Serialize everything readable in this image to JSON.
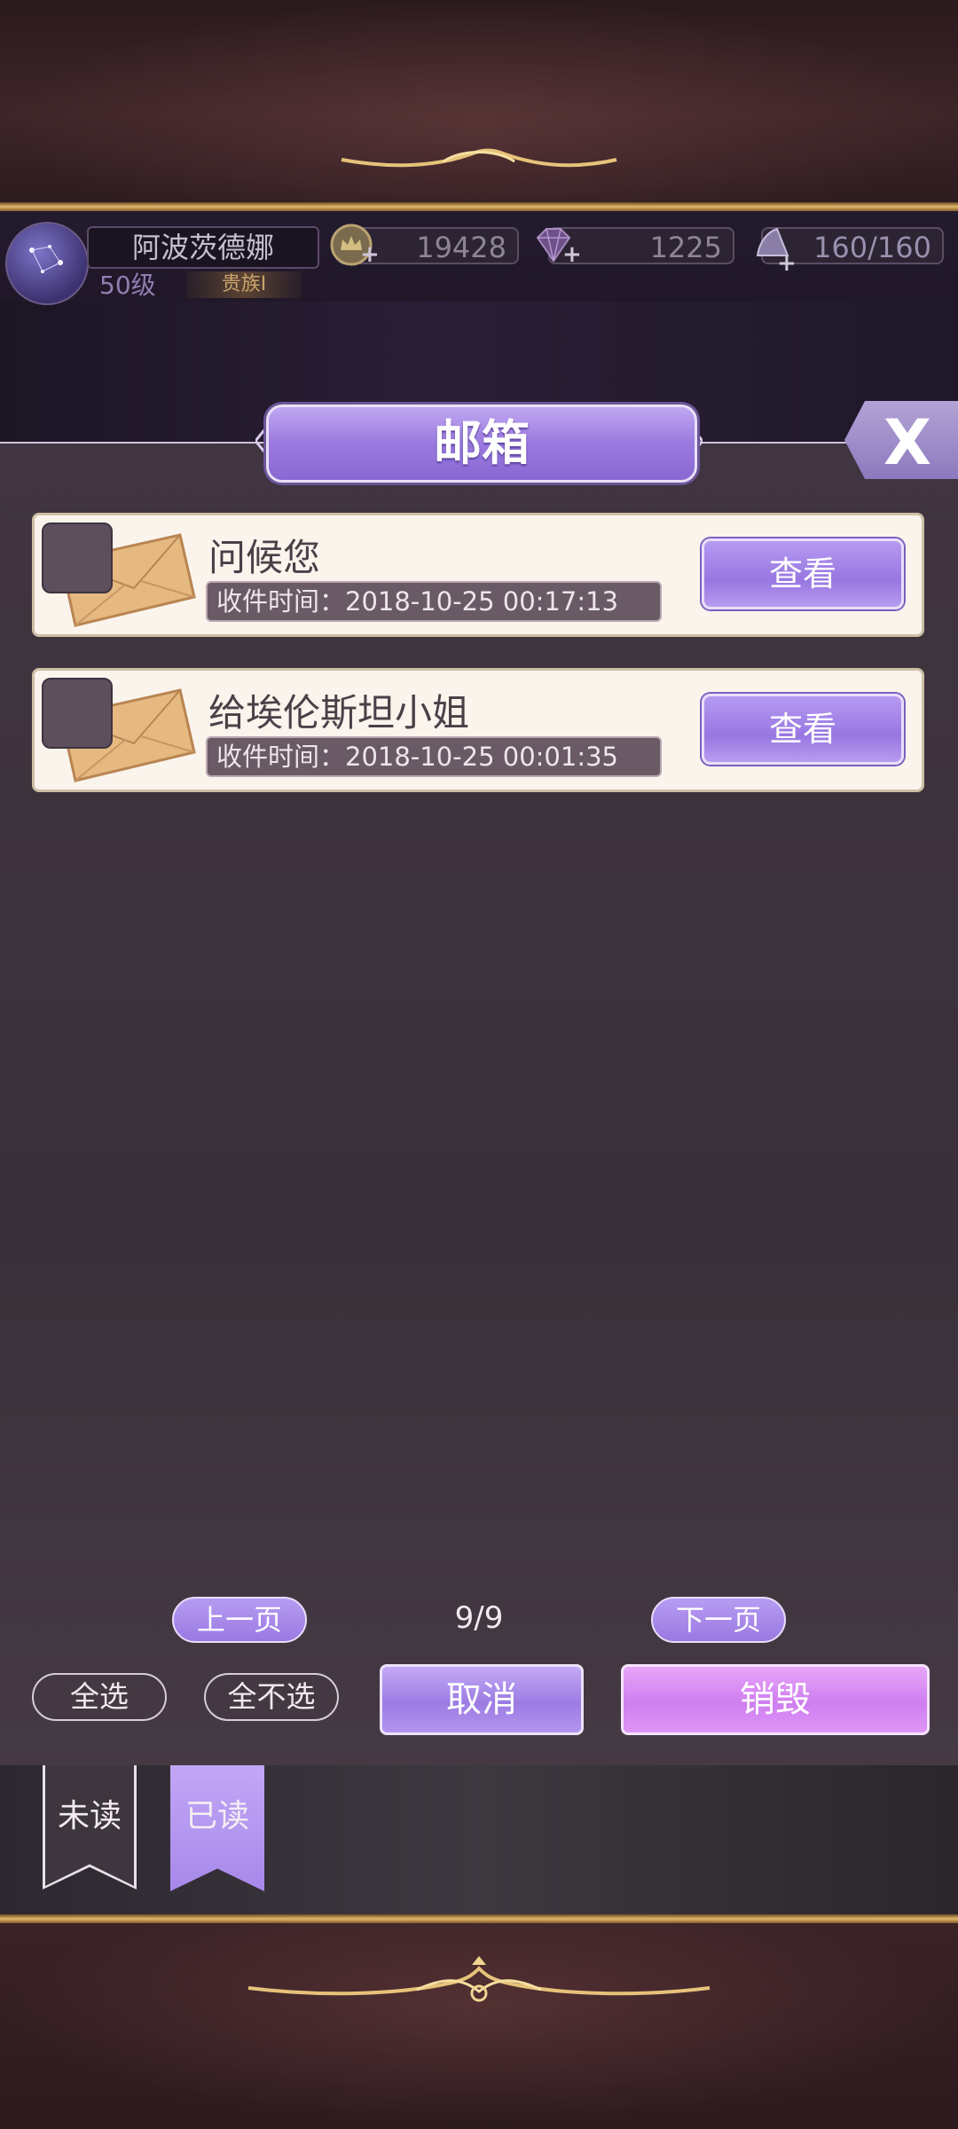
{
  "hud": {
    "player_name": "阿波茨德娜",
    "level": "50级",
    "rank": "贵族I",
    "gold": "19428",
    "gems": "1225",
    "stamina": "160/160",
    "plus": "+"
  },
  "dialog": {
    "title": "邮箱",
    "close_label": "X"
  },
  "mails": [
    {
      "title": "问候您",
      "time": "收件时间：2018-10-25 00:17:13",
      "view_label": "查看"
    },
    {
      "title": "给埃伦斯坦小姐",
      "time": "收件时间：2018-10-25 00:01:35",
      "view_label": "查看"
    }
  ],
  "pagination": {
    "prev": "上一页",
    "indicator": "9/9",
    "next": "下一页"
  },
  "actions": {
    "select_all": "全选",
    "deselect_all": "全不选",
    "cancel": "取消",
    "destroy": "销毁"
  },
  "tabs": {
    "unread": "未读",
    "read": "已读",
    "active": "read"
  },
  "colors": {
    "accent_purple": "#9a79e2",
    "destroy_pink": "#cf7ef0",
    "gold": "#e0b86a"
  }
}
